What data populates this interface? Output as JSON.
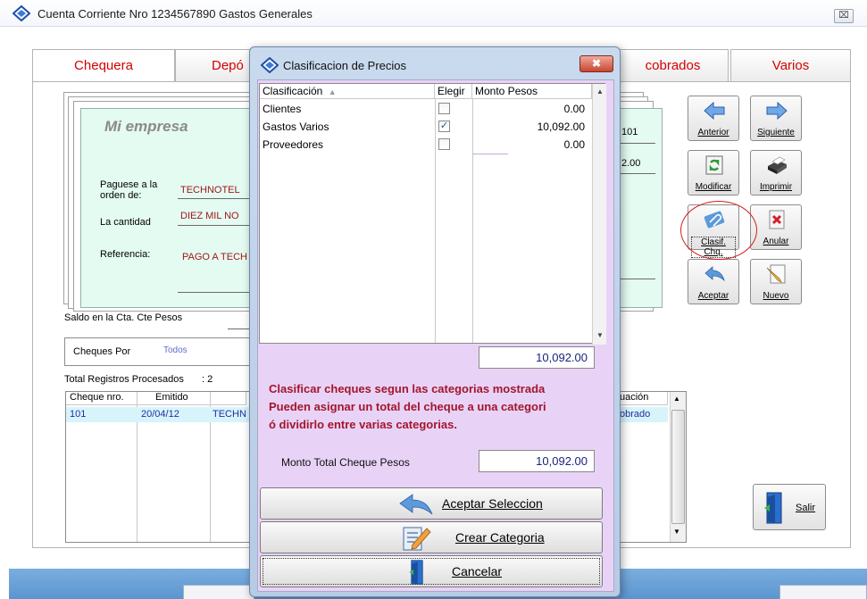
{
  "window": {
    "title": "Cuenta Corriente Nro 1234567890 Gastos Generales",
    "close_label": "⌧"
  },
  "tabs": [
    {
      "label": "Chequera"
    },
    {
      "label": "Depó"
    },
    {
      "label": "cobrados"
    },
    {
      "label": "Varios"
    }
  ],
  "cheque": {
    "company": "Mi empresa",
    "number": "101",
    "amount": "2.00",
    "payee_label": "Paguese a la orden de:",
    "payee_value": "TECHNOTEL",
    "amount_label": "La cantidad",
    "amount_words": "DIEZ MIL NO",
    "reference_label": "Referencia:",
    "reference_value": "PAGO A TECH"
  },
  "side_buttons": {
    "anterior": "Anterior",
    "siguiente": "Siguiente",
    "modificar": "Modificar",
    "imprimir": "Imprimir",
    "clasif": "Clasif. Chq.",
    "anular": "Anular",
    "aceptar": "Aceptar",
    "nuevo": "Nuevo",
    "salir": "Salir"
  },
  "balance": {
    "label": "Saldo en la Cta. Cte Pesos"
  },
  "filter": {
    "label": "Cheques Por",
    "value": "Todos"
  },
  "records": {
    "label": "Total Registros Procesados",
    "count": ": 2"
  },
  "grid": {
    "headers": [
      "Cheque nro.",
      "Emitido",
      "uación"
    ],
    "rows": [
      {
        "cheque": "101",
        "emitido": "20/04/12",
        "payee": "TECHN",
        "status": "obrado"
      }
    ]
  },
  "dialog": {
    "title": "Clasificacion de Precios",
    "close_label": "✖",
    "columns": [
      "Clasificación",
      "Elegir",
      "Monto Pesos"
    ],
    "rows": [
      {
        "name": "Clientes",
        "checked": false,
        "amount": "0.00"
      },
      {
        "name": "Gastos Varios",
        "checked": true,
        "amount": "10,092.00"
      },
      {
        "name": "Proveedores",
        "checked": false,
        "amount": "0.00"
      }
    ],
    "subtotal": "10,092.00",
    "info_lines": [
      "Clasificar cheques segun las categorias mostrada",
      "Pueden asignar un total del cheque a una categori",
      "ó dividirlo entre varias categorias."
    ],
    "total_label": "Monto Total Cheque Pesos",
    "total_value": "10,092.00",
    "buttons": {
      "accept": "Aceptar Seleccion",
      "create": "Crear Categoria",
      "cancel": "Cancelar"
    }
  }
}
